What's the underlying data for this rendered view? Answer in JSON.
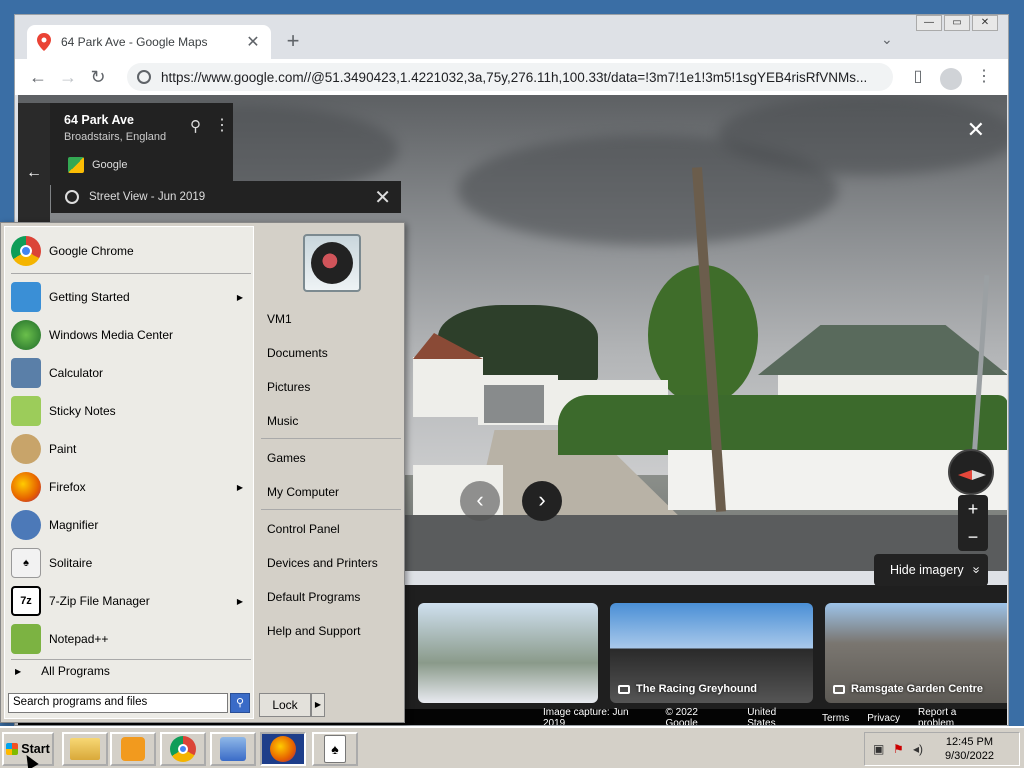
{
  "browser": {
    "tab_title": "64 Park Ave - Google Maps",
    "tab_close": "✕",
    "new_tab": "+",
    "tab_search": "⌄",
    "url": "https://www.google.com//@51.3490423,1.4221032,3a,75y,276.11h,100.33t/data=!3m7!1e1!3m5!1sgYEB4risRfVNMs...",
    "back": "←",
    "forward": "→",
    "reload": "↻",
    "menu": "⋮",
    "sidepanel": "▯",
    "win_min": "—",
    "win_max": "▭",
    "win_close": "✕"
  },
  "place": {
    "name": "64 Park Ave",
    "locality": "Broadstairs, England",
    "source": "Google",
    "back": "←",
    "pin": "⚲",
    "more": "⋮"
  },
  "streetview": {
    "bar_label": "Street View - Jun 2019",
    "bar_close": "✕",
    "close": "✕",
    "prev": "‹",
    "next": "›",
    "zoom_in": "+",
    "zoom_out": "−",
    "hide_imagery": "Hide imagery",
    "hide_imagery_icon": "»"
  },
  "thumbnails": [
    {
      "caption": ""
    },
    {
      "caption": "The Racing Greyhound"
    },
    {
      "caption": "Ramsgate Garden Centre"
    }
  ],
  "footer": {
    "capture": "Image capture: Jun 2019",
    "copyright": "© 2022 Google",
    "region": "United States",
    "terms": "Terms",
    "privacy": "Privacy",
    "report": "Report a problem"
  },
  "start_menu": {
    "pinned": [
      {
        "label": "Google Chrome",
        "icon": "chrome-icon",
        "color": "#db4437"
      }
    ],
    "recent": [
      {
        "label": "Getting Started",
        "icon": "getting-started-icon",
        "has_submenu": true,
        "color": "#3a8fd6"
      },
      {
        "label": "Windows Media Center",
        "icon": "media-center-icon",
        "has_submenu": false,
        "color": "#2d7d3a"
      },
      {
        "label": "Calculator",
        "icon": "calculator-icon",
        "has_submenu": false,
        "color": "#5a7fa8"
      },
      {
        "label": "Sticky Notes",
        "icon": "sticky-notes-icon",
        "has_submenu": false,
        "color": "#9ccc5a"
      },
      {
        "label": "Paint",
        "icon": "paint-icon",
        "has_submenu": false,
        "color": "#c8a46a"
      },
      {
        "label": "Firefox",
        "icon": "firefox-icon",
        "has_submenu": true,
        "color": "#e66000"
      },
      {
        "label": "Magnifier",
        "icon": "magnifier-icon",
        "has_submenu": false,
        "color": "#4c79b8"
      },
      {
        "label": "Solitaire",
        "icon": "solitaire-icon",
        "has_submenu": false,
        "color": "#6b6b6b"
      },
      {
        "label": "7-Zip File Manager",
        "icon": "7zip-icon",
        "has_submenu": true,
        "color": "#000000"
      },
      {
        "label": "Notepad++",
        "icon": "notepad-plus-plus-icon",
        "has_submenu": false,
        "color": "#7cb342"
      }
    ],
    "all_programs": "All Programs",
    "search_placeholder": "Search programs and files",
    "right": [
      {
        "label": "VM1"
      },
      {
        "label": "Documents"
      },
      {
        "label": "Pictures"
      },
      {
        "label": "Music"
      },
      {
        "label": "Games"
      },
      {
        "label": "My Computer"
      },
      {
        "label": "Control Panel"
      },
      {
        "label": "Devices and Printers"
      },
      {
        "label": "Default Programs"
      },
      {
        "label": "Help and Support"
      }
    ],
    "lock": "Lock",
    "lock_arrow": "▶",
    "seven_zip_text": "7z"
  },
  "taskbar": {
    "start": "Start",
    "time": "12:45 PM",
    "date": "9/30/2022",
    "apps": [
      "explorer-icon",
      "media-player-icon",
      "chrome-icon",
      "control-panel-icon",
      "firefox-icon",
      "solitaire-icon"
    ]
  }
}
